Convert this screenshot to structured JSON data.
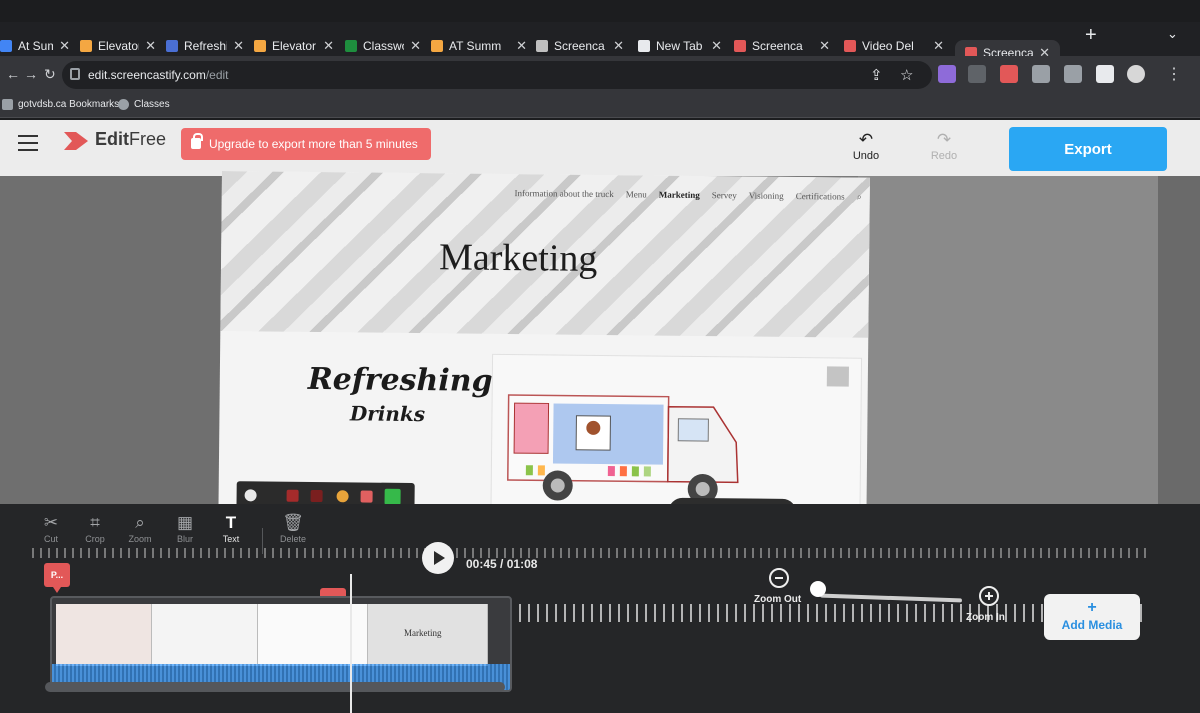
{
  "browser": {
    "tabs": [
      {
        "title": "At Summ",
        "favicon_color": "#4285f4"
      },
      {
        "title": "Elevator F",
        "favicon_color": "#f4a742"
      },
      {
        "title": "Refreshin",
        "favicon_color": "#4a6fd4"
      },
      {
        "title": "Elevator F",
        "favicon_color": "#f4a742"
      },
      {
        "title": "Classwork",
        "favicon_color": "#1e8e3e"
      },
      {
        "title": "AT Summ",
        "favicon_color": "#f4a742"
      },
      {
        "title": "Screenca",
        "favicon_color": "#c0c0c0"
      },
      {
        "title": "New Tab",
        "favicon_color": "#e8eaed"
      },
      {
        "title": "Screenca",
        "favicon_color": "#e25858"
      },
      {
        "title": "Video Del",
        "favicon_color": "#e25858"
      },
      {
        "title": "Screenca",
        "favicon_color": "#e25858"
      }
    ],
    "active_tab_index": 10,
    "url_host": "edit.screencastify.com",
    "url_path": "/edit",
    "bookmarks": [
      "gotvdsb.ca Bookmarks",
      "Classes"
    ]
  },
  "editor": {
    "logo_edit": "Edit",
    "logo_free": "Free",
    "upgrade_label": "Upgrade to export more than 5 minutes",
    "undo_label": "Undo",
    "redo_label": "Redo",
    "export_label": "Export"
  },
  "preview": {
    "nav_items": [
      "Information about the truck",
      "Menu",
      "Marketing",
      "Servey",
      "Visioning",
      "Certifications"
    ],
    "active_nav": "Marketing",
    "hero_title": "Marketing",
    "brand_line1": "Refreshing",
    "brand_line2": "Drinks"
  },
  "toolbar": {
    "tools": [
      "Cut",
      "Crop",
      "Zoom",
      "Blur",
      "Text",
      "Delete"
    ]
  },
  "playback": {
    "current_time": "00:45",
    "total_time": "01:08"
  },
  "timeline": {
    "marker_label": "P...",
    "zoom_out_label": "Zoom Out",
    "zoom_in_label": "Zoom In",
    "add_media_label": "Add Media",
    "clip_thumb_title": "Marketing"
  },
  "colors": {
    "accent": "#2aa7f3",
    "upgrade": "#ef6b6b",
    "marker": "#e25858"
  }
}
